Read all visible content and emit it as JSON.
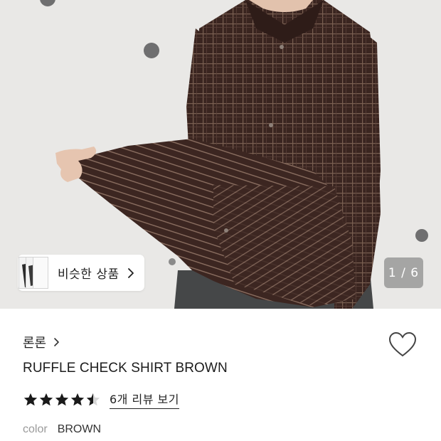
{
  "hero": {
    "photo_alt": "model wearing brown ruffle check shirt",
    "similar_button_label": "비슷한 상품",
    "pager_text": "1 / 6"
  },
  "product": {
    "brand": "론론",
    "title": "RUFFLE CHECK SHIRT BROWN",
    "rating": 4.5,
    "rating_max": 5,
    "reviews_link": "6개 리뷰 보기",
    "color_label": "color",
    "color_value": "BROWN"
  },
  "colors": {
    "shirt": "#3b2620",
    "wall": "#e9e8e6",
    "text": "#222222",
    "muted": "#9a9a9a"
  }
}
